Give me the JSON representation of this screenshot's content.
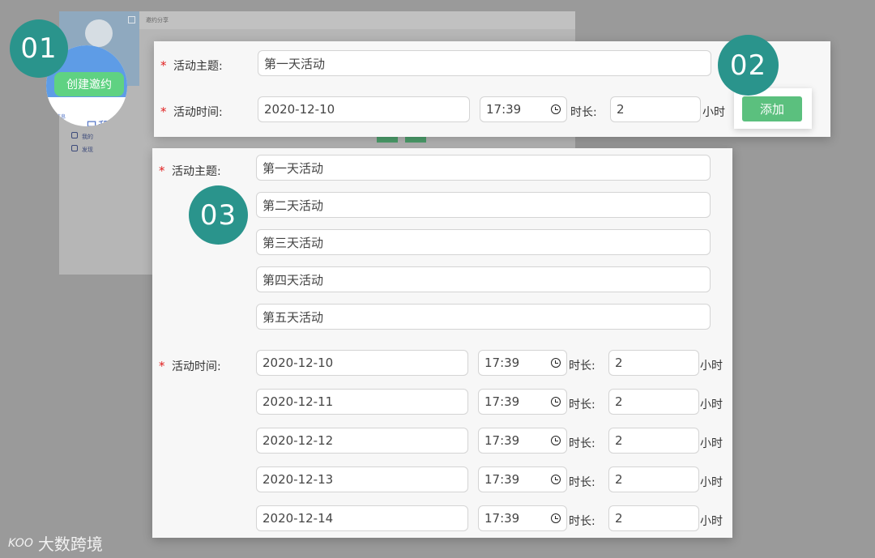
{
  "background": {
    "window_title": "邀约分享",
    "sidebar_items": [
      "我的",
      "发现"
    ],
    "zoom": {
      "create_button": "创建邀约",
      "small_text": "邀约信息",
      "big_text": "日程"
    }
  },
  "badges": {
    "step1": "01",
    "step2": "02",
    "step3": "03"
  },
  "panel_top": {
    "topic_label": "活动主题:",
    "time_label": "活动时间:",
    "topic_value": "第一天活动",
    "date_value": "2020-12-10",
    "time_value": "17:39",
    "duration_label": "时长:",
    "duration_value": "2",
    "unit_label": "小时",
    "add_button": "添加"
  },
  "panel_bottom": {
    "topic_label": "活动主题:",
    "time_label": "活动时间:",
    "topics": [
      "第一天活动",
      "第二天活动",
      "第三天活动",
      "第四天活动",
      "第五天活动"
    ],
    "rows": [
      {
        "date": "2020-12-10",
        "time": "17:39",
        "duration": "2"
      },
      {
        "date": "2020-12-11",
        "time": "17:39",
        "duration": "2"
      },
      {
        "date": "2020-12-12",
        "time": "17:39",
        "duration": "2"
      },
      {
        "date": "2020-12-13",
        "time": "17:39",
        "duration": "2"
      },
      {
        "date": "2020-12-14",
        "time": "17:39",
        "duration": "2"
      }
    ],
    "duration_label": "时长:",
    "unit_label": "小时"
  },
  "required_mark": "*",
  "watermark": {
    "logo": "KOO",
    "text": "大数跨境"
  },
  "colors": {
    "badge": "#2a948c",
    "add_button": "#5bc07e",
    "required": "#e02020"
  }
}
